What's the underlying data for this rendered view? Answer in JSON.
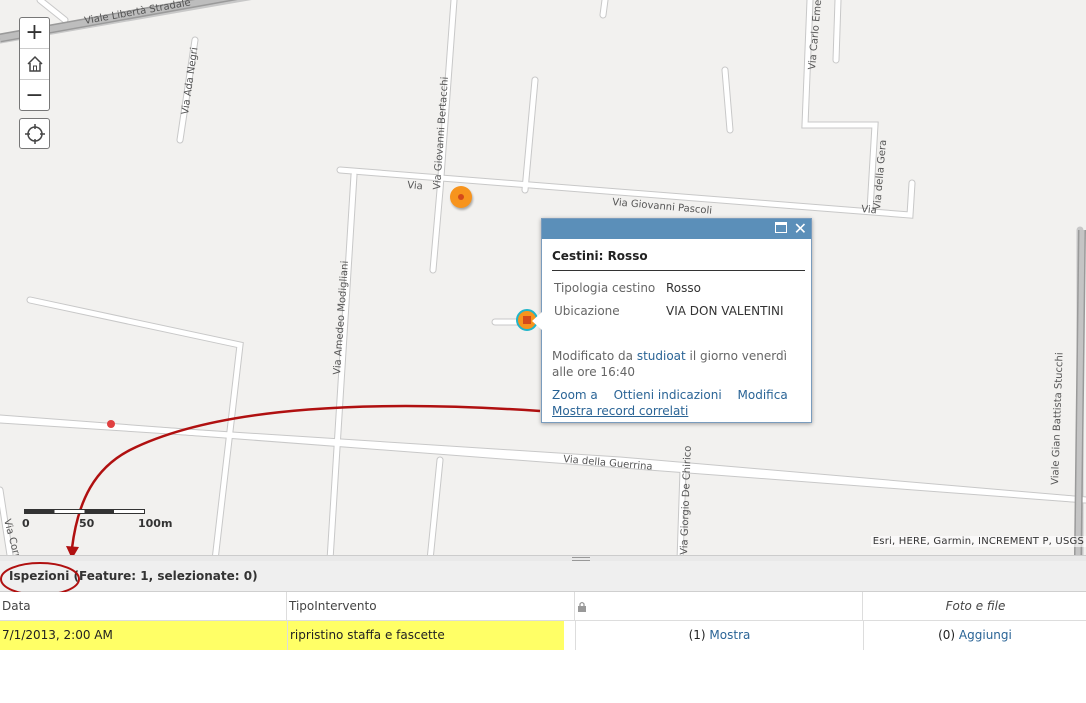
{
  "map": {
    "zoom_in_label": "+",
    "zoom_out_label": "−",
    "home_icon": "home-icon",
    "locate_icon": "locate-icon",
    "street_labels": [
      "Viale Libertà Stradale",
      "Via Ada Negri",
      "Via Giovanni Bertacchi",
      "Via Giovanni Pascoli",
      "Via Carlo Emery",
      "Via della Gera",
      "Via Amedeo Modigliani",
      "Via della Guerrina",
      "Viale Gian Battista Stucchi",
      "Via Giorgio De Chirico",
      "Via Correggio",
      "Via",
      "Via"
    ],
    "scalebar": {
      "label_0": "0",
      "label_50": "50",
      "label_100": "100m"
    },
    "attribution": "Esri, HERE, Garmin, INCREMENT P, USGS"
  },
  "popup": {
    "title": "Cestini: Rosso",
    "fields": [
      {
        "label": "Tipologia cestino",
        "value": "Rosso"
      },
      {
        "label": "Ubicazione",
        "value": "VIA DON VALENTINI"
      }
    ],
    "modified_prefix": "Modificato da ",
    "modified_user": "studioat",
    "modified_suffix": " il giorno venerdì",
    "modified_time": "alle ore 16:40",
    "action_zoom": "Zoom a",
    "action_directions": "Ottieni indicazioni",
    "action_edit": "Modifica",
    "action_related": "Mostra record correlati"
  },
  "table": {
    "layer_name": "Ispezioni",
    "summary": " (Feature: 1, selezionate: 0)",
    "columns": [
      "Data",
      "TipoIntervento",
      "",
      "Foto e file"
    ],
    "rows": [
      {
        "data": "7/1/2013, 2:00 AM",
        "tipo": "ripristino staffa e fascette",
        "related_count": "(1) ",
        "related_link": "Mostra",
        "files_count": "(0) ",
        "files_link": "Aggiungi"
      }
    ]
  },
  "colors": {
    "popup_header": "#5b8fb9",
    "highlight_row": "#ffff66",
    "annotation_red": "#b01010",
    "marker_orange": "#f7941d"
  }
}
